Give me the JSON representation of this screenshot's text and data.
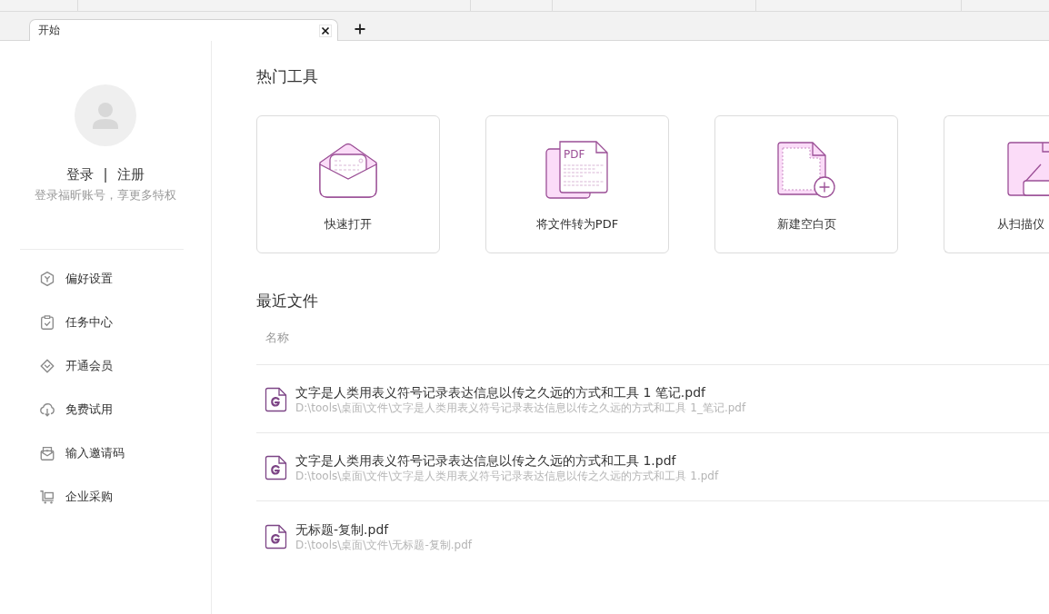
{
  "tabs": [
    {
      "label": "开始",
      "selected": true
    }
  ],
  "sidebar": {
    "login": "登录",
    "separator": "|",
    "register": "注册",
    "subtitle": "登录福昕账号，享更多特权",
    "items": [
      {
        "label": "偏好设置"
      },
      {
        "label": "任务中心"
      },
      {
        "label": "开通会员"
      },
      {
        "label": "免费试用"
      },
      {
        "label": "输入邀请码"
      },
      {
        "label": "企业采购"
      }
    ]
  },
  "hot_tools": {
    "title": "热门工具",
    "cards": [
      {
        "label": "快速打开"
      },
      {
        "label": "将文件转为PDF",
        "icon_text": "PDF"
      },
      {
        "label": "新建空白页"
      },
      {
        "label": "从扫描仪"
      }
    ]
  },
  "recent_files": {
    "title": "最近文件",
    "column": "名称",
    "files": [
      {
        "name": "文字是人类用表义符号记录表达信息以传之久远的方式和工具 1 笔记.pdf",
        "path": "D:\\tools\\桌面\\文件\\文字是人类用表义符号记录表达信息以传之久远的方式和工具 1_笔记.pdf"
      },
      {
        "name": "文字是人类用表义符号记录表达信息以传之久远的方式和工具 1.pdf",
        "path": "D:\\tools\\桌面\\文件\\文字是人类用表义符号记录表达信息以传之久远的方式和工具 1.pdf"
      },
      {
        "name": "无标题-复制.pdf",
        "path": "D:\\tools\\桌面\\文件\\无标题-复制.pdf"
      }
    ]
  }
}
